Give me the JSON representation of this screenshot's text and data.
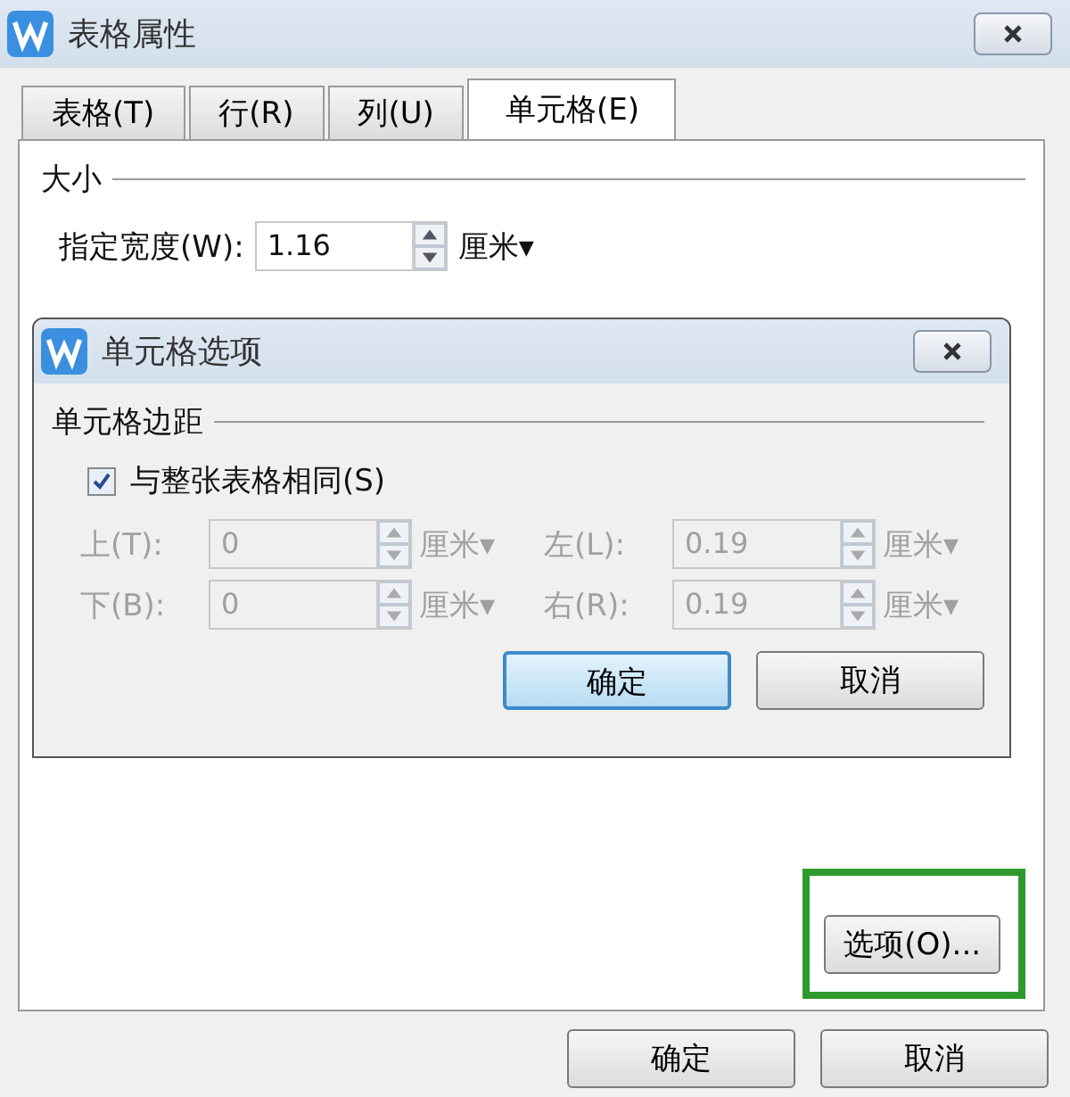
{
  "window": {
    "title": "表格属性"
  },
  "tabs": [
    {
      "label": "表格(T)",
      "selected": false
    },
    {
      "label": "行(R)",
      "selected": false
    },
    {
      "label": "列(U)",
      "selected": false
    },
    {
      "label": "单元格(E)",
      "selected": true
    }
  ],
  "size_section": {
    "title": "大小",
    "width_label": "指定宽度(W):",
    "width_value": "1.16",
    "unit": "厘米▾"
  },
  "options_button": {
    "label": "选项(O)...",
    "highlighted": true
  },
  "buttons": [
    {
      "label": "确定"
    },
    {
      "label": "取消"
    }
  ],
  "dialog": {
    "title": "单元格选项",
    "group_title": "单元格边距",
    "same_as_table": {
      "label": "与整张表格相同(S)",
      "checked": true
    },
    "margins": [
      {
        "label": "上(T):",
        "value": "0",
        "unit": "厘米▾",
        "disabled": true
      },
      {
        "label": "左(L):",
        "value": "0.19",
        "unit": "厘米▾",
        "disabled": true
      },
      {
        "label": "下(B):",
        "value": "0",
        "unit": "厘米▾",
        "disabled": true
      },
      {
        "label": "右(R):",
        "value": "0.19",
        "unit": "厘米▾",
        "disabled": true
      }
    ],
    "buttons": [
      {
        "label": "确定",
        "default": true
      },
      {
        "label": "取消",
        "default": false
      }
    ]
  }
}
